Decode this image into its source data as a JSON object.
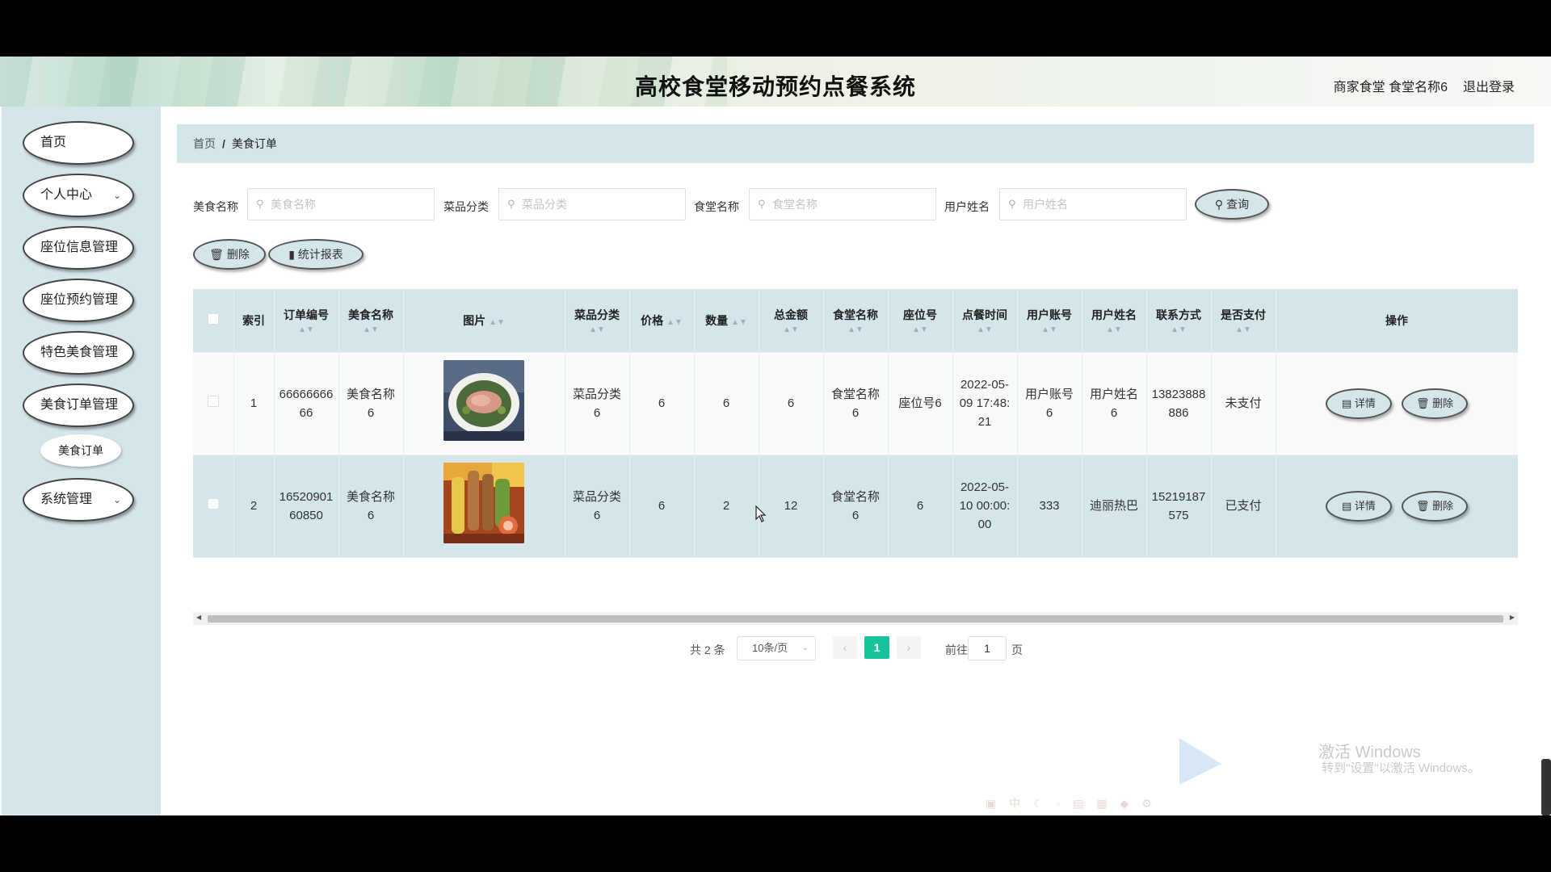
{
  "app": {
    "title": "高校食堂移动预约点餐系统",
    "user_info": "商家食堂 食堂名称6",
    "logout": "退出登录"
  },
  "sidebar": {
    "items": [
      {
        "label": "首页",
        "has_submenu": false
      },
      {
        "label": "个人中心",
        "has_submenu": true
      },
      {
        "label": "座位信息管理",
        "has_submenu": false
      },
      {
        "label": "座位预约管理",
        "has_submenu": false
      },
      {
        "label": "特色美食管理",
        "has_submenu": false
      },
      {
        "label": "美食订单管理",
        "has_submenu": false,
        "expanded": true
      },
      {
        "label": "系统管理",
        "has_submenu": true
      }
    ],
    "sub_item": "美食订单"
  },
  "breadcrumb": {
    "home": "首页",
    "separator": "/",
    "current": "美食订单"
  },
  "search": {
    "fields": [
      {
        "label": "美食名称",
        "placeholder": "美食名称"
      },
      {
        "label": "菜品分类",
        "placeholder": "菜品分类"
      },
      {
        "label": "食堂名称",
        "placeholder": "食堂名称"
      },
      {
        "label": "用户姓名",
        "placeholder": "用户姓名"
      }
    ],
    "query_button": "查询"
  },
  "actions": {
    "delete": "删除",
    "report": "统计报表"
  },
  "table": {
    "columns": [
      "索引",
      "订单编号",
      "美食名称",
      "图片",
      "菜品分类",
      "价格",
      "数量",
      "总金额",
      "食堂名称",
      "座位号",
      "点餐时间",
      "用户账号",
      "用户姓名",
      "联系方式",
      "是否支付",
      "操作"
    ],
    "rows": [
      {
        "index": "1",
        "order_no": "6666666666",
        "food_name": "美食名称6",
        "image": "plated-fish-dish",
        "category": "菜品分类6",
        "price": "6",
        "quantity": "6",
        "total": "6",
        "canteen": "食堂名称6",
        "seat": "座位号6",
        "time": "2022-05-09 17:48:21",
        "account": "用户账号6",
        "username": "用户姓名6",
        "phone": "13823888886",
        "paid": "未支付"
      },
      {
        "index": "2",
        "order_no": "1652090160850",
        "food_name": "美食名称6",
        "image": "grilled-skewers-dish",
        "category": "菜品分类6",
        "price": "6",
        "quantity": "2",
        "total": "12",
        "canteen": "食堂名称6",
        "seat": "6",
        "time": "2022-05-10 00:00:00",
        "account": "333",
        "username": "迪丽热巴",
        "phone": "15219187575",
        "paid": "已支付"
      }
    ],
    "row_actions": {
      "detail": "详情",
      "delete": "删除"
    }
  },
  "pagination": {
    "total": "共 2 条",
    "page_size": "10条/页",
    "current_page": "1",
    "goto_label": "前往",
    "goto_value": "1",
    "page_suffix": "页"
  },
  "watermark": {
    "line1": "激活 Windows",
    "line2": "转到\"设置\"以激活 Windows。"
  },
  "colors": {
    "panel": "#d5e6ea",
    "accent": "#17c39b"
  }
}
